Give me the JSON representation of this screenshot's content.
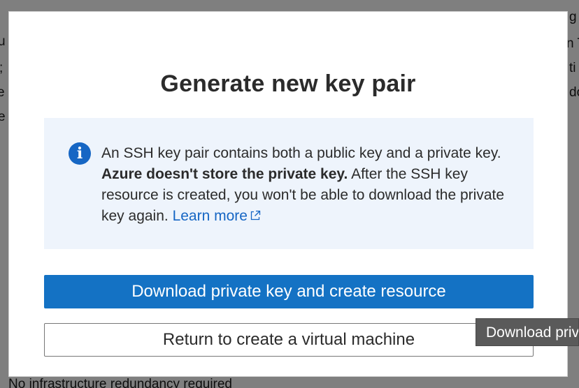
{
  "background": {
    "fragments": {
      "left_1": "l",
      "left_2": "u",
      "left_3": ";",
      "left_4": "e",
      "left_5": "e",
      "right_1": "g",
      "right_2": "n T",
      "right_3": "ti",
      "right_4": "do",
      "bottom_text": "No infrastructure redundancy required"
    }
  },
  "dialog": {
    "title": "Generate new key pair",
    "info": {
      "text_before_bold": "An SSH key pair contains both a public key and a private key. ",
      "bold_text": "Azure doesn't store the private key.",
      "text_after_bold": " After the SSH key resource is created, you won't be able to download the private key again. ",
      "link_text": "Learn more"
    },
    "primary_button": "Download private key and create resource",
    "secondary_button": "Return to create a virtual machine"
  },
  "tooltip": {
    "text": "Download private key and create resource"
  },
  "colors": {
    "accent": "#1472c4",
    "link": "#1666c4",
    "info_background": "#eef4fc"
  },
  "icons": {
    "info": "info-circle-icon",
    "external_link": "external-link-icon"
  }
}
